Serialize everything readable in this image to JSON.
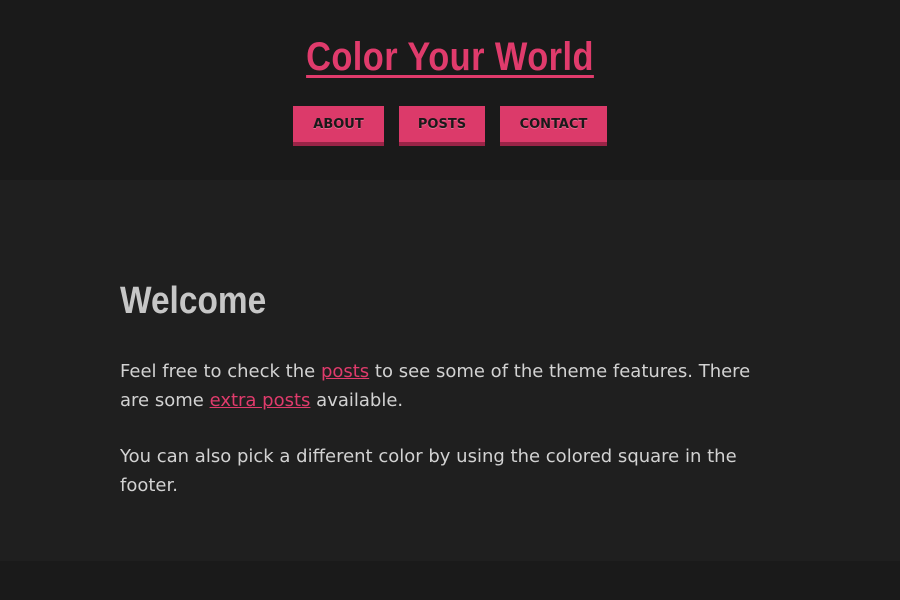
{
  "header": {
    "site_title": "Color Your World",
    "nav": [
      {
        "label": "ABOUT"
      },
      {
        "label": "POSTS"
      },
      {
        "label": "CONTACT"
      }
    ]
  },
  "main": {
    "heading": "Welcome",
    "paragraph1": {
      "text_before": "Feel free to check the ",
      "link1": "posts",
      "text_middle": " to see some of the theme features. There are some ",
      "link2": "extra posts",
      "text_after": " available."
    },
    "paragraph2": "You can also pick a different color by using the colored square in the footer."
  },
  "colors": {
    "accent": "#dc3a6a",
    "background": "#1f1f1f",
    "header_background": "#1a1a1a",
    "text": "#d2d2d2"
  }
}
